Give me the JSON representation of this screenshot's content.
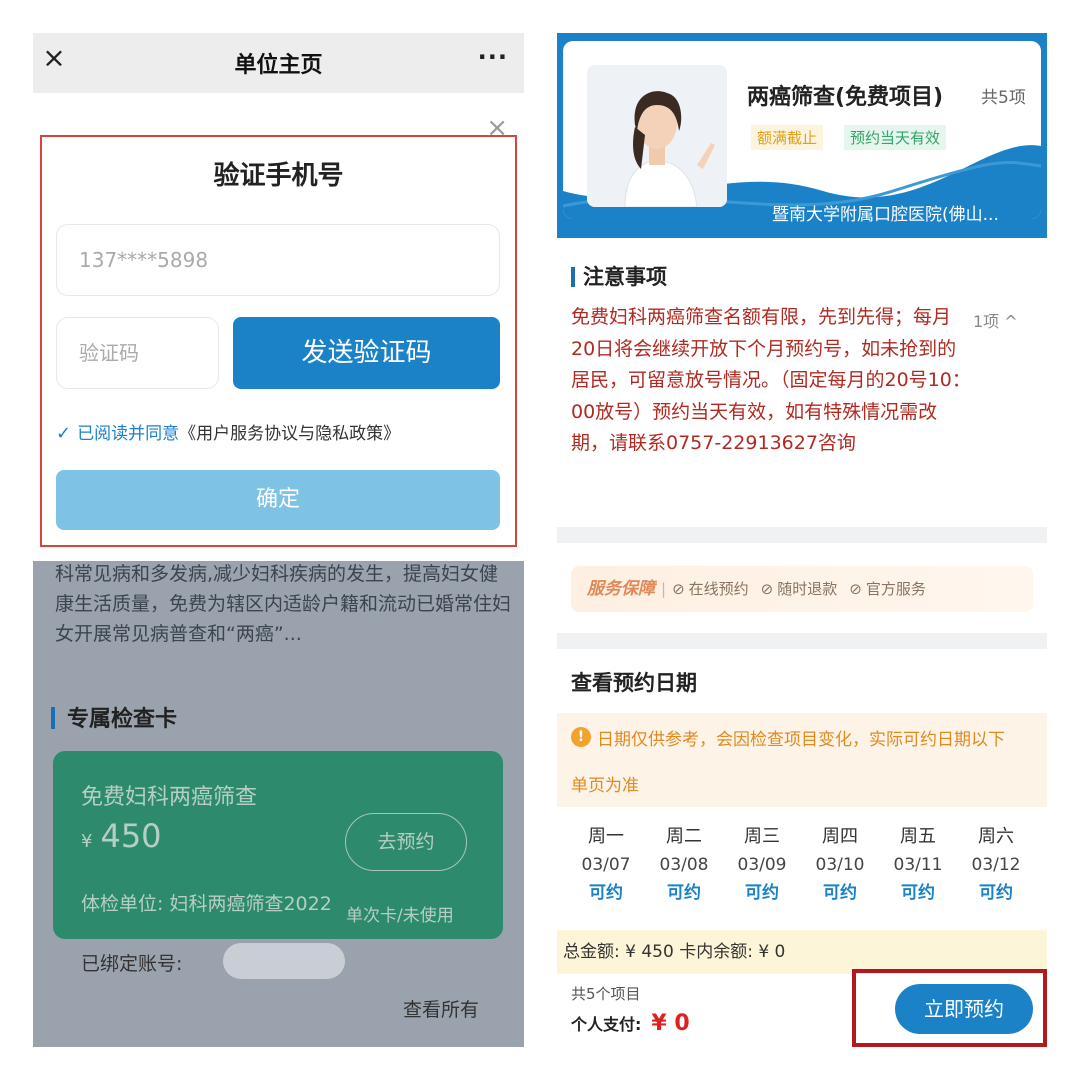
{
  "left": {
    "titlebar": {
      "title": "单位主页",
      "close_icon": "×",
      "more_icon": "···"
    },
    "dialog": {
      "close_icon": "×",
      "title": "验证手机号",
      "phone_value": "137****5898",
      "code_placeholder": "验证码",
      "send_button": "发送验证码",
      "agree_check": "✓",
      "agree_label": "已阅读并同意",
      "agree_link": "《用户服务协议与隐私政策》",
      "confirm_button": "确定"
    },
    "description": "科常见病和多发病,减少妇科疾病的发生，提高妇女健康生活质量，免费为辖区内适龄户籍和流动已婚常住妇女开展常见病普查和“两癌”...",
    "section_title": "专属检查卡",
    "card": {
      "name": "免费妇科两癌筛查",
      "currency": "¥",
      "price": "450",
      "action_button": "去预约",
      "unit_label": "体检单位: 妇科两癌筛查2022",
      "status": "单次卡/未使用"
    },
    "bound_account_label": "已绑定账号:",
    "see_all_link": "查看所有"
  },
  "right": {
    "banner": {
      "title": "两癌筛查(免费项目)",
      "item_count": "共5项",
      "tag_quota": "额满截止",
      "tag_valid": "预约当天有效",
      "hospital": "暨南大学附属口腔医院(佛山..."
    },
    "notice": {
      "title": "注意事项",
      "text": "免费妇科两癌筛查名额有限，先到先得；每月20日将会继续开放下个月预约号，如未抢到的居民，可留意放号情况。（固定每月的20号10：00放号）预约当天有效，如有特殊情况需改期，请联系0757-22913627咨询",
      "count": "1项 ^"
    },
    "service": {
      "title": "服务保障",
      "items": [
        "在线预约",
        "随时退款",
        "官方服务"
      ]
    },
    "dates": {
      "title": "查看预约日期",
      "notice_line1": "日期仅供参考，会因检查项目变化，实际可约日期以下",
      "notice_line2": "单页为准",
      "days": [
        {
          "weekday": "周一",
          "date": "03/07",
          "status": "可约"
        },
        {
          "weekday": "周二",
          "date": "03/08",
          "status": "可约"
        },
        {
          "weekday": "周三",
          "date": "03/09",
          "status": "可约"
        },
        {
          "weekday": "周四",
          "date": "03/10",
          "status": "可约"
        },
        {
          "weekday": "周五",
          "date": "03/11",
          "status": "可约"
        },
        {
          "weekday": "周六",
          "date": "03/12",
          "status": "可约"
        }
      ]
    },
    "footer": {
      "totals": "总金额: ¥ 450   卡内余额: ¥ 0",
      "items_count": "共5个项目",
      "pay_label": "个人支付:",
      "pay_amount": "¥ 0",
      "book_button": "立即预约"
    }
  },
  "colors": {
    "brand_blue": "#1b82c8",
    "notice_red": "#b02a22",
    "warning_orange": "#e08a22",
    "card_green": "#2e8a6c",
    "highlight_frame": "#b3171f"
  }
}
